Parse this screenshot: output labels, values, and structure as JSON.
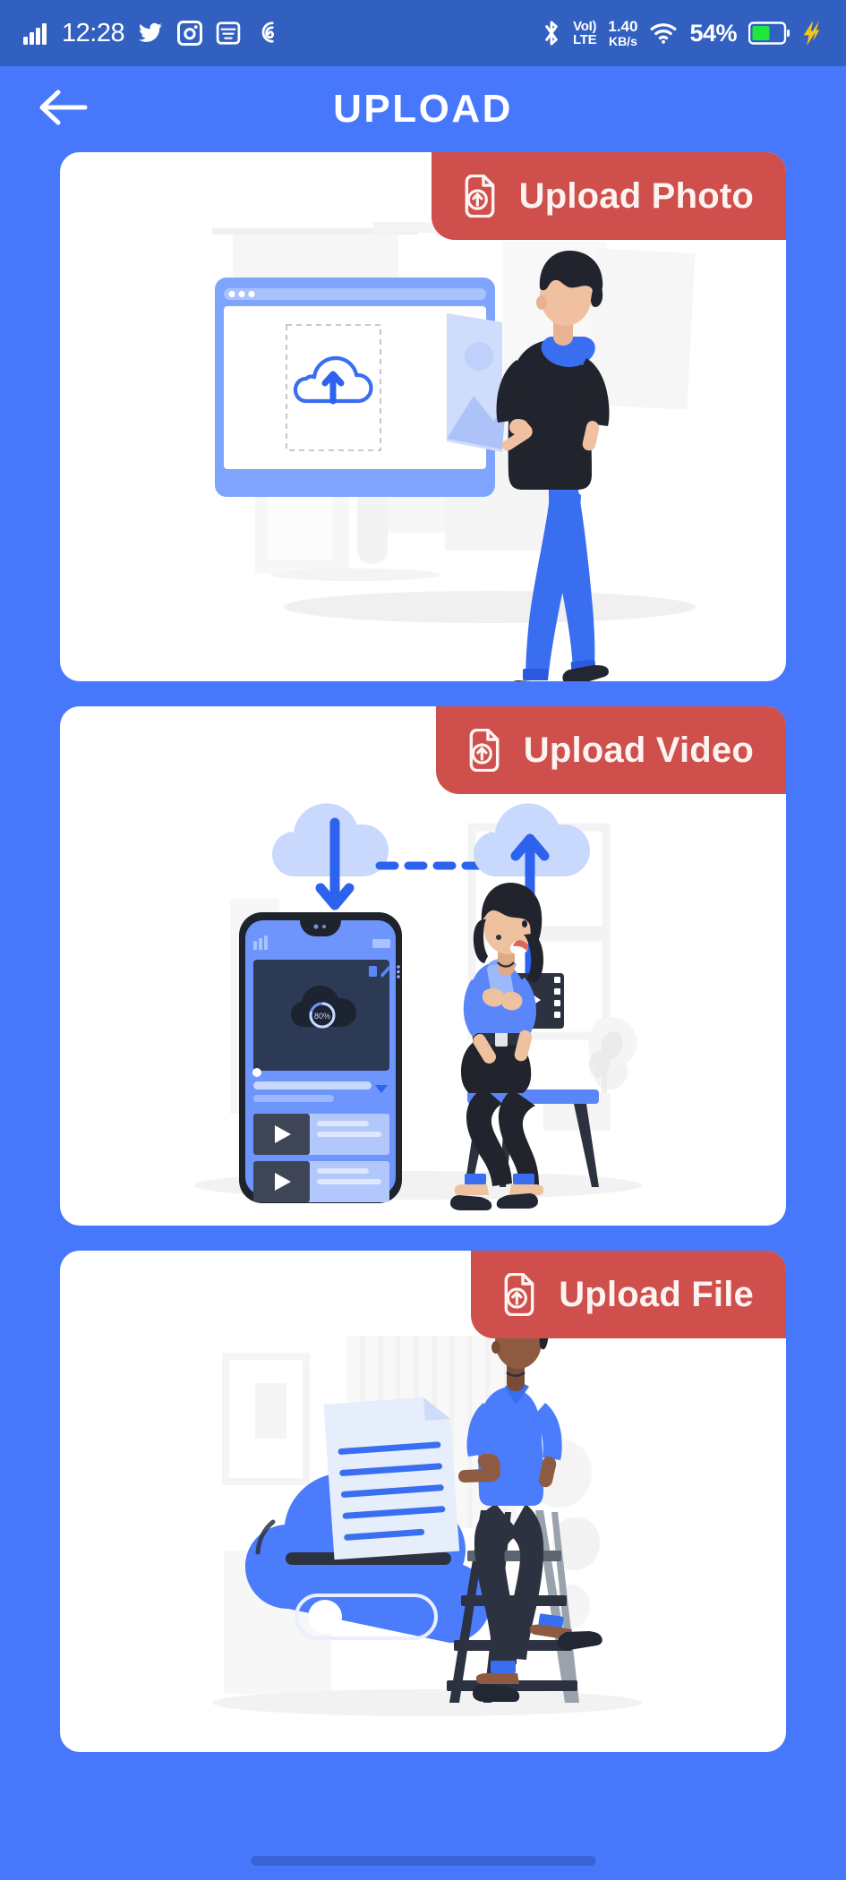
{
  "status_bar": {
    "time": "12:28",
    "signal_icon": "cellular-signal-icon",
    "app_icons": [
      "twitter-icon",
      "instagram-icon",
      "mail-icon",
      "link-icon"
    ],
    "bluetooth_icon": "bluetooth-icon",
    "volte_line1": "VoLTE",
    "volte_top": "VoI)",
    "volte_bottom": "LTE",
    "net_speed_value": "1.40",
    "net_speed_unit": "KB/s",
    "wifi_icon": "wifi-icon",
    "battery_percent": "54%",
    "battery_icon": "battery-icon",
    "charging_icon": "charging-bolt-icon",
    "background_color": "#3260c0"
  },
  "header": {
    "back_icon": "arrow-left-icon",
    "title": "UPLOAD",
    "background_color": "#4778fb"
  },
  "theme": {
    "page_background": "#4778fb",
    "card_background": "#ffffff",
    "badge_background": "#ce4f4b",
    "badge_text_color": "#fdf3f0",
    "illustration_blue": "#4a7cfb",
    "illustration_dark": "#2f3545"
  },
  "cards": [
    {
      "id": "upload-photo",
      "badge_label": "Upload Photo",
      "badge_icon": "file-upload-icon",
      "illustration": "person-uploading-photo-to-browser-window"
    },
    {
      "id": "upload-video",
      "badge_label": "Upload Video",
      "badge_icon": "file-upload-icon",
      "illustration": "woman-uploading-video-from-phone-to-cloud"
    },
    {
      "id": "upload-file",
      "badge_label": "Upload File",
      "badge_icon": "file-upload-icon",
      "illustration": "man-on-ladder-feeding-document-into-cloud"
    }
  ],
  "nav_pill": {
    "label": "gesture-navigation-bar"
  }
}
